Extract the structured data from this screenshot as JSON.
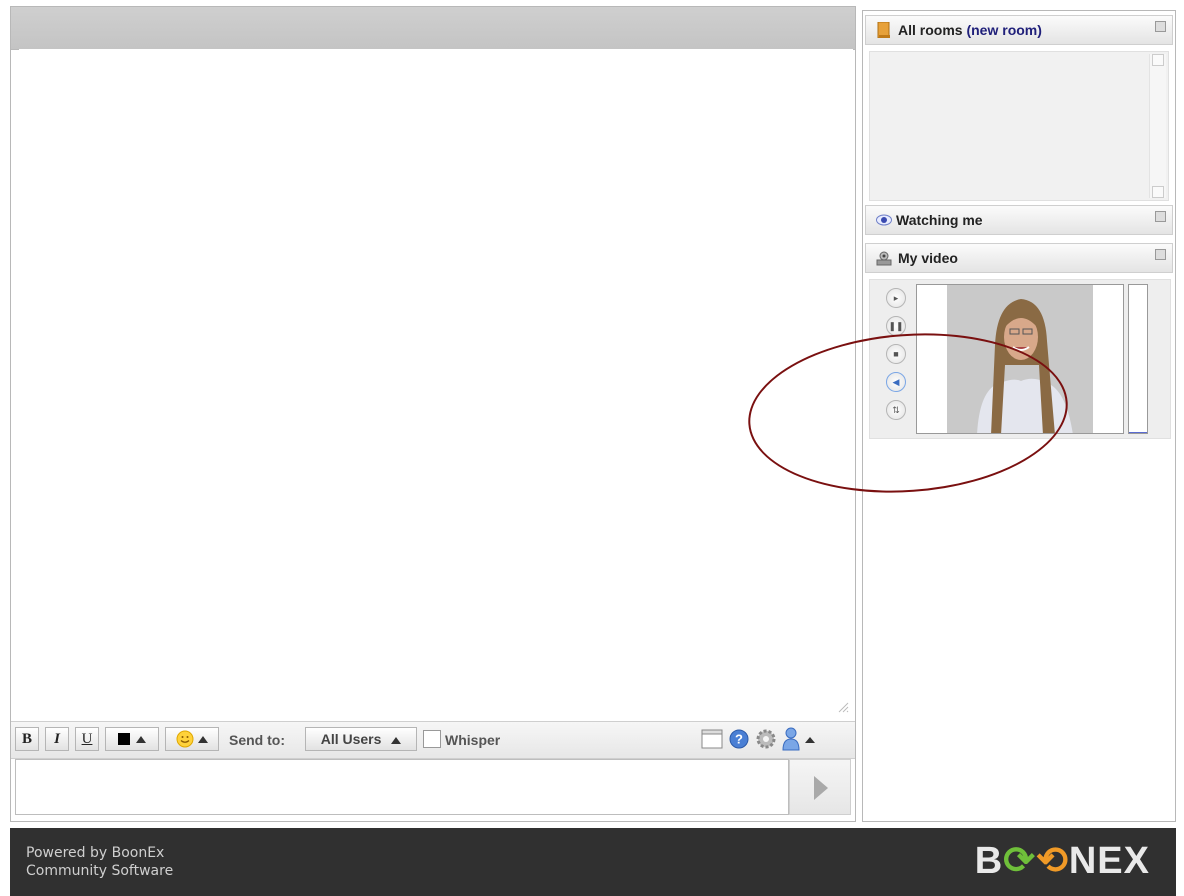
{
  "toolbar": {
    "bold_label": "B",
    "italic_label": "I",
    "underline_label": "U",
    "send_to_label": "Send to:",
    "recipient_selected": "All Users",
    "whisper_label": "Whisper",
    "text_color": "#000000"
  },
  "sidebar": {
    "rooms": {
      "title": "All rooms",
      "new_room_link": "(new room)"
    },
    "watching": {
      "title": "Watching me"
    },
    "my_video": {
      "title": "My video",
      "mic_level_percent": 1
    }
  },
  "footer": {
    "line1": "Powered by BoonEx",
    "line2": "Community Software",
    "logo_b": "B",
    "logo_nex": "NEX"
  },
  "colors": {
    "link": "#20207a",
    "annotation_ring": "#7a1010",
    "footer_bg": "#303030"
  },
  "icons": {
    "rooms": "folder-icon",
    "watching": "eye-icon",
    "my_video": "webcam-icon",
    "toolbar_right": [
      "window-icon",
      "help-icon",
      "gear-icon",
      "user-icon"
    ]
  }
}
